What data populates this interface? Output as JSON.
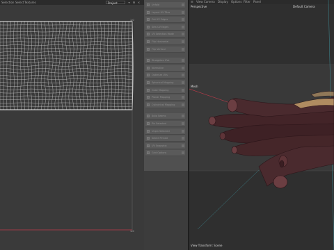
{
  "uv_editor": {
    "menu": [
      "Selection",
      "Select",
      "Textures"
    ],
    "projection": "Project",
    "axis_labels": {
      "v_top": "1.0",
      "u_right": "1.0",
      "u_bottom": "1.0"
    }
  },
  "tool_panel": {
    "items": [
      "Unfold",
      "Layout UV Tiles",
      "Cut UV Edges",
      "Sew UV Edges",
      "UV Selection Mode",
      "Flip Horizontal",
      "Flip Vertical",
      "",
      "Straighten UVs",
      "Normalize",
      "Optimize UVs",
      "Spherical Mapping",
      "Cube Mapping",
      "Planar Mapping",
      "Cylindrical Mapping",
      "",
      "Auto Seams",
      "Pin Selected",
      "Unpin Selected",
      "Select Pinned",
      "UV Snapshot",
      "Grid Options"
    ]
  },
  "viewport": {
    "menu": [
      "View",
      "Camera",
      "Display",
      "Options",
      "Filter",
      "Panel"
    ],
    "perspective_label": "Perspective",
    "camera_label": "Default Camera",
    "object_label": "Mesh",
    "status_label": "View Transform: Scene"
  },
  "colors": {
    "accent_red": "#c33a4a",
    "axis_cyan": "#45b6c4",
    "mesh_wood": "#4a2a2e"
  }
}
